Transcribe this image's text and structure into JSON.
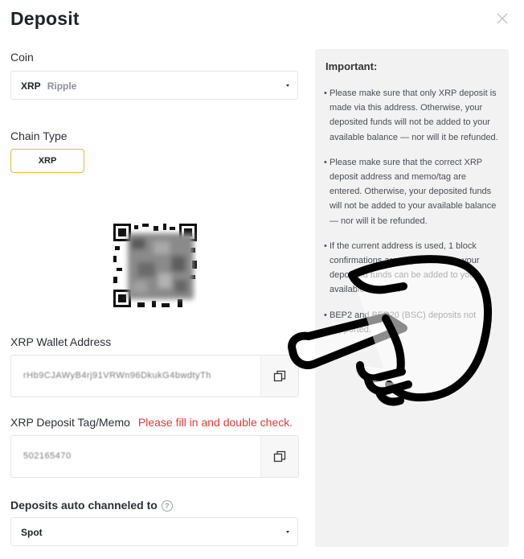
{
  "header": {
    "title": "Deposit"
  },
  "coin": {
    "label": "Coin",
    "symbol": "XRP",
    "name": "Ripple"
  },
  "chain": {
    "label": "Chain Type",
    "selected": "XRP"
  },
  "address": {
    "label": "XRP Wallet Address",
    "value": "rHb9CJAWyB4rj91VRWn96DkukG4bwdtyTh"
  },
  "memo": {
    "label": "XRP Deposit Tag/Memo",
    "warning": "Please fill in and double check.",
    "value": "502165470"
  },
  "channel": {
    "label": "Deposits auto channeled to",
    "help": "?",
    "selected": "Spot"
  },
  "important": {
    "title": "Important:",
    "notes": [
      "Please make sure that only XRP deposit is made via this address. Otherwise, your deposited funds will not be added to your available balance — nor will it be refunded.",
      "Please make sure that the correct XRP deposit address and memo/tag are entered. Otherwise, your deposited funds will not be added to your available balance — nor will it be refunded.",
      "If the current address is used, 1 block confirmations are required before your deposited funds can be added to your available balance.",
      "BEP2 and BEP20 (BSC) deposits not supported."
    ]
  },
  "colors": {
    "accent": "#e8b93e",
    "warning": "#e53935",
    "panel": "#f2f2f2"
  },
  "icons": {
    "close": "close-icon",
    "copy": "copy-icon",
    "help": "help-circle-icon",
    "hand": "pointing-hand-icon"
  }
}
